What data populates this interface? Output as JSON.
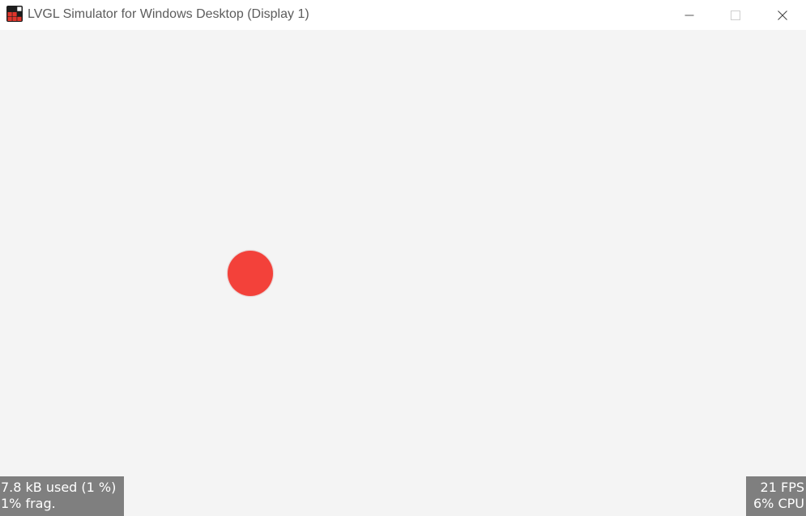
{
  "window": {
    "title": "LVGL Simulator for Windows Desktop (Display 1)",
    "app_icon": "lvgl-app-icon",
    "controls": {
      "minimize_icon": "minimize-icon",
      "maximize_icon": "maximize-icon",
      "close_icon": "close-icon"
    }
  },
  "canvas": {
    "background_color": "#f4f4f4",
    "ball_color": "#f3413a"
  },
  "monitors": {
    "memory": {
      "used_line": "7.8 kB used (1 %)",
      "frag_line": "1% frag."
    },
    "performance": {
      "fps_line": "21 FPS",
      "cpu_line": "6% CPU"
    },
    "overlay_color": "#7f7f7f"
  }
}
